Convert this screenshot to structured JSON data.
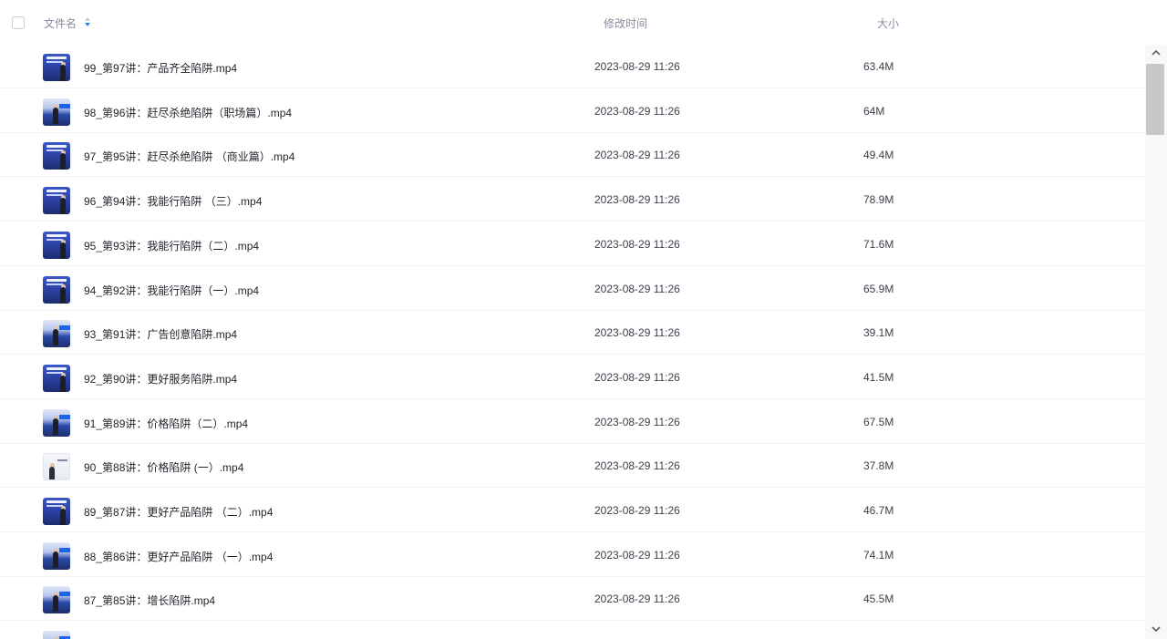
{
  "header": {
    "name_label": "文件名",
    "time_label": "修改时间",
    "size_label": "大小",
    "sort_icon": "sort-ascending-icon",
    "sort_color": "#2b7df6"
  },
  "files": [
    {
      "name": "99_第97讲：产品齐全陷阱.mp4",
      "time": "2023-08-29 11:26",
      "size": "63.4M",
      "thumb": "t1"
    },
    {
      "name": "98_第96讲：赶尽杀绝陷阱（职场篇）.mp4",
      "time": "2023-08-29 11:26",
      "size": "64M",
      "thumb": "t2"
    },
    {
      "name": "97_第95讲：赶尽杀绝陷阱 （商业篇）.mp4",
      "time": "2023-08-29 11:26",
      "size": "49.4M",
      "thumb": "t1"
    },
    {
      "name": "96_第94讲：我能行陷阱 （三）.mp4",
      "time": "2023-08-29 11:26",
      "size": "78.9M",
      "thumb": "t1"
    },
    {
      "name": "95_第93讲：我能行陷阱（二）.mp4",
      "time": "2023-08-29 11:26",
      "size": "71.6M",
      "thumb": "t1"
    },
    {
      "name": "94_第92讲：我能行陷阱（一）.mp4",
      "time": "2023-08-29 11:26",
      "size": "65.9M",
      "thumb": "t1"
    },
    {
      "name": "93_第91讲：广告创意陷阱.mp4",
      "time": "2023-08-29 11:26",
      "size": "39.1M",
      "thumb": "t2"
    },
    {
      "name": "92_第90讲：更好服务陷阱.mp4",
      "time": "2023-08-29 11:26",
      "size": "41.5M",
      "thumb": "t1"
    },
    {
      "name": "91_第89讲：价格陷阱（二）.mp4",
      "time": "2023-08-29 11:26",
      "size": "67.5M",
      "thumb": "t2"
    },
    {
      "name": "90_第88讲：价格陷阱 (一）.mp4",
      "time": "2023-08-29 11:26",
      "size": "37.8M",
      "thumb": "t3"
    },
    {
      "name": "89_第87讲：更好产品陷阱 （二）.mp4",
      "time": "2023-08-29 11:26",
      "size": "46.7M",
      "thumb": "t1"
    },
    {
      "name": "88_第86讲：更好产品陷阱 （一）.mp4",
      "time": "2023-08-29 11:26",
      "size": "74.1M",
      "thumb": "t2"
    },
    {
      "name": "87_第85讲：增长陷阱.mp4",
      "time": "2023-08-29 11:26",
      "size": "45.5M",
      "thumb": "t2"
    },
    {
      "name": "",
      "time": "",
      "size": "",
      "thumb": "t2"
    }
  ],
  "scrollbar": {
    "up_icon": "chevron-up-icon",
    "down_icon": "chevron-down-icon"
  }
}
